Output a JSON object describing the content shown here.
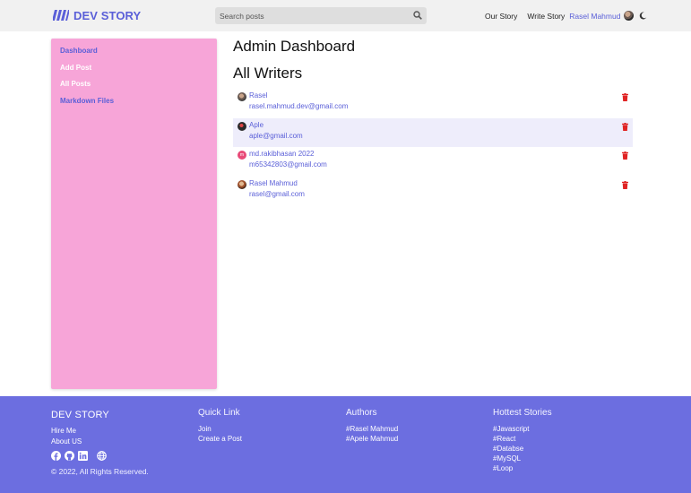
{
  "navbar": {
    "brand": "DEV STORY",
    "search_placeholder": "Search posts",
    "links": [
      "Our Story",
      "Write Story"
    ],
    "user_name": "Rasel Mahmud"
  },
  "sidebar": {
    "items": [
      {
        "label": "Dashboard"
      },
      {
        "label": "Add Post"
      },
      {
        "label": "All Posts"
      },
      {
        "label": "Markdown Files"
      }
    ]
  },
  "main": {
    "page_title": "Admin Dashboard",
    "section_title": "All Writers",
    "writers": [
      {
        "name": "Rasel",
        "email": "rasel.mahmud.dev@gmail.com"
      },
      {
        "name": "Aple",
        "email": "aple@gmail.com"
      },
      {
        "name": "md.rakibhasan 2022",
        "email": "m65342803@gmail.com",
        "initial": "m"
      },
      {
        "name": "Rasel Mahmud",
        "email": "rasel@gmail.com"
      }
    ]
  },
  "footer": {
    "brand": "DEV STORY",
    "links": [
      "Hire Me",
      "About US"
    ],
    "copyright": "© 2022, All Rights Reserved.",
    "quick_link": {
      "title": "Quick Link",
      "items": [
        "Join",
        "Create a Post"
      ]
    },
    "authors": {
      "title": "Authors",
      "items": [
        "#Rasel Mahmud",
        "#Apele Mahmud"
      ]
    },
    "hottest": {
      "title": "Hottest Stories",
      "items": [
        "#Javascript",
        "#React",
        "#Databse",
        "#MySQL",
        "#Loop"
      ]
    }
  },
  "colors": {
    "accent": "#5a5fd8",
    "sidebar_bg": "#f7a5d8",
    "footer_bg": "#6c6ee0",
    "delete": "#e02424"
  },
  "icons": {
    "logo": "logo-stripes-icon",
    "search": "search-icon",
    "theme": "moon-icon",
    "delete": "trash-icon",
    "social": [
      "facebook-icon",
      "github-icon",
      "linkedin-icon",
      "globe-icon"
    ]
  }
}
